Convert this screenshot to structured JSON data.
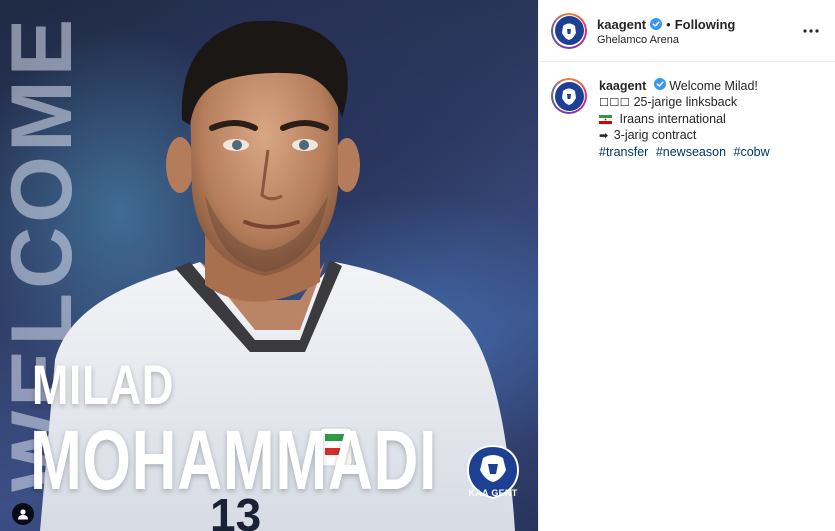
{
  "post": {
    "poster_text": {
      "vertical_word": "WELCOME",
      "first_name": "MILAD",
      "last_name": "MOHAMMADI",
      "club_badge_text": "KAA GENT"
    }
  },
  "header": {
    "username": "kaagent",
    "separator": "•",
    "follow_status": "Following",
    "location": "Ghelamco Arena"
  },
  "caption": {
    "username": "kaagent",
    "headline": "Welcome Milad!",
    "line1_prefix": "☐☐☐",
    "line1_text": "25-jarige linksback",
    "line2_text": "Iraans international",
    "line3_prefix": "➡",
    "line3_text": "3-jarig contract",
    "hashtags": [
      "#transfer",
      "#newseason",
      "#cobw"
    ]
  },
  "icons": {
    "verified": "verified-badge-icon",
    "more": "more-options-icon",
    "tag_user": "user-tag-icon",
    "flag": "iran-flag-icon"
  },
  "colors": {
    "accent_link": "#00376b",
    "verified_blue": "#3897f0",
    "club_blue": "#1d3f94"
  }
}
